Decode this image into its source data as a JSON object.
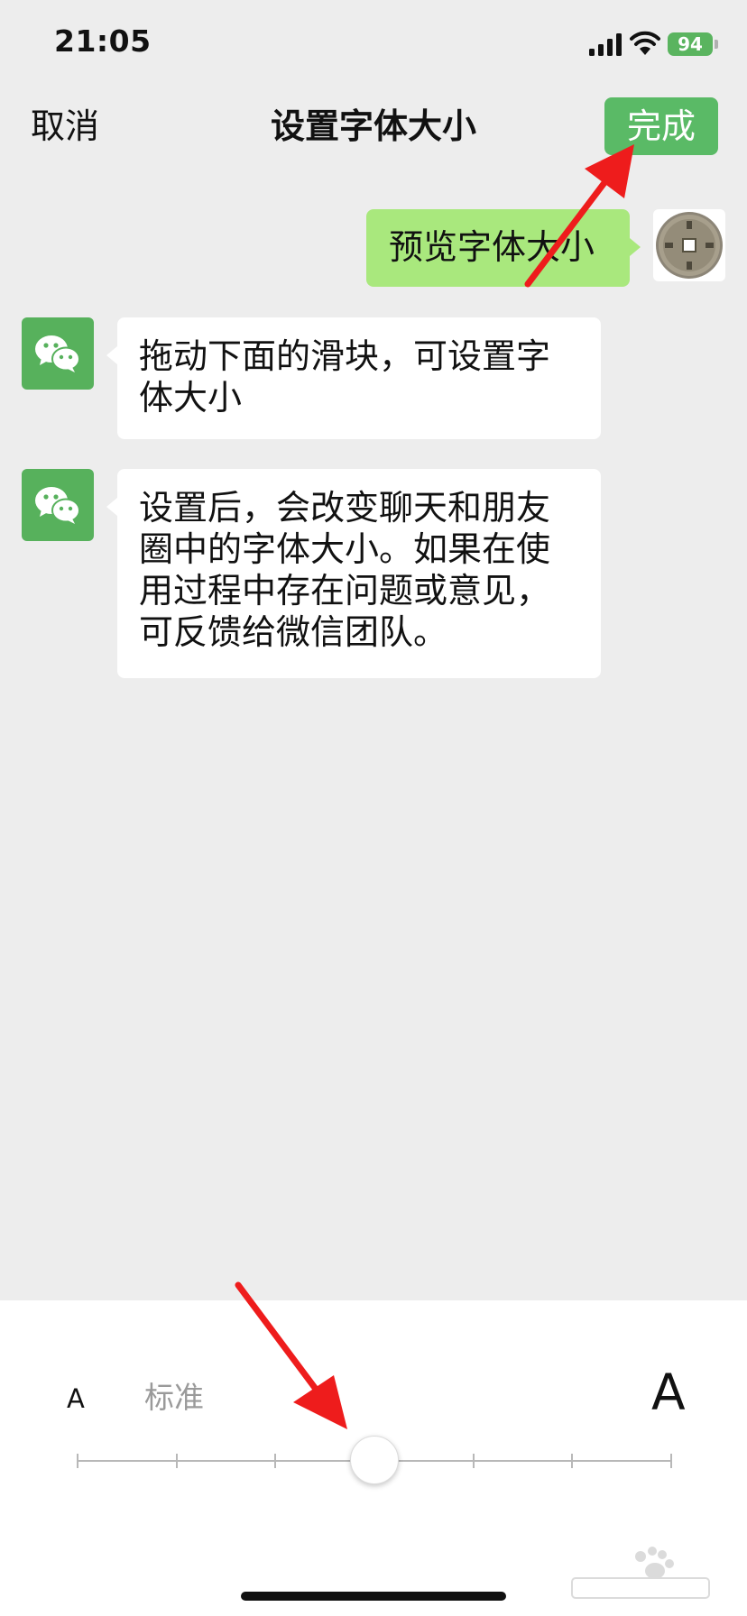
{
  "status_bar": {
    "time": "21:05",
    "battery": "94"
  },
  "nav": {
    "cancel_label": "取消",
    "title": "设置字体大小",
    "done_label": "完成"
  },
  "chat": {
    "preview_message": "预览字体大小",
    "messages": [
      "拖动下面的滑块，可设置字\n体大小",
      "设置后，会改变聊天和朋友\n圈中的字体大小。如果在使\n用过程中存在问题或意见，\n可反馈给微信团队。"
    ]
  },
  "font_size_panel": {
    "small_label": "A",
    "current_level_label": "标准",
    "large_label": "A",
    "slider": {
      "steps": 7,
      "selected_step": 4
    }
  },
  "colors": {
    "accent": "#5aba66",
    "outgoing_bubble": "#a9e87d",
    "background": "#ededed",
    "annotation_arrow": "#ee1c1c"
  },
  "icons": {
    "signal": "signal-bars-icon",
    "wifi": "wifi-icon",
    "wechat_avatar": "wechat-logo-icon",
    "user_avatar": "coin-avatar-icon"
  }
}
